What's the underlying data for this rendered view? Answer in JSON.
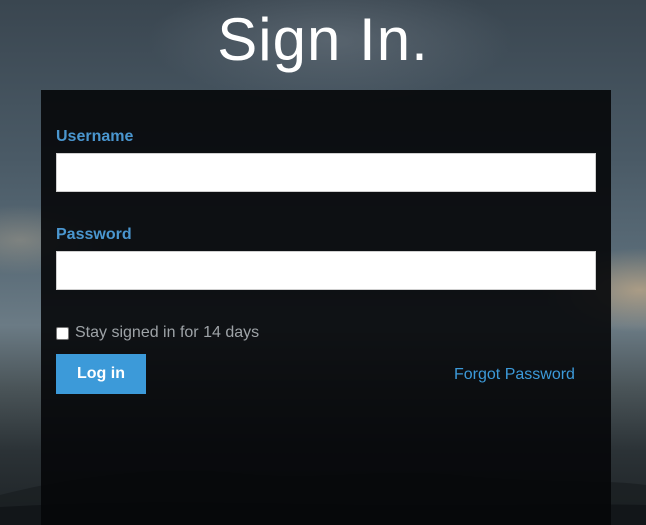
{
  "header": {
    "title": "Sign In."
  },
  "form": {
    "username_label": "Username",
    "username_value": "",
    "password_label": "Password",
    "password_value": "",
    "remember_label": "Stay signed in for 14 days",
    "remember_checked": false,
    "login_button_label": "Log in",
    "forgot_link_label": "Forgot Password"
  },
  "colors": {
    "accent": "#3c9ad9",
    "label": "#4a96cf",
    "panel": "#050709"
  }
}
